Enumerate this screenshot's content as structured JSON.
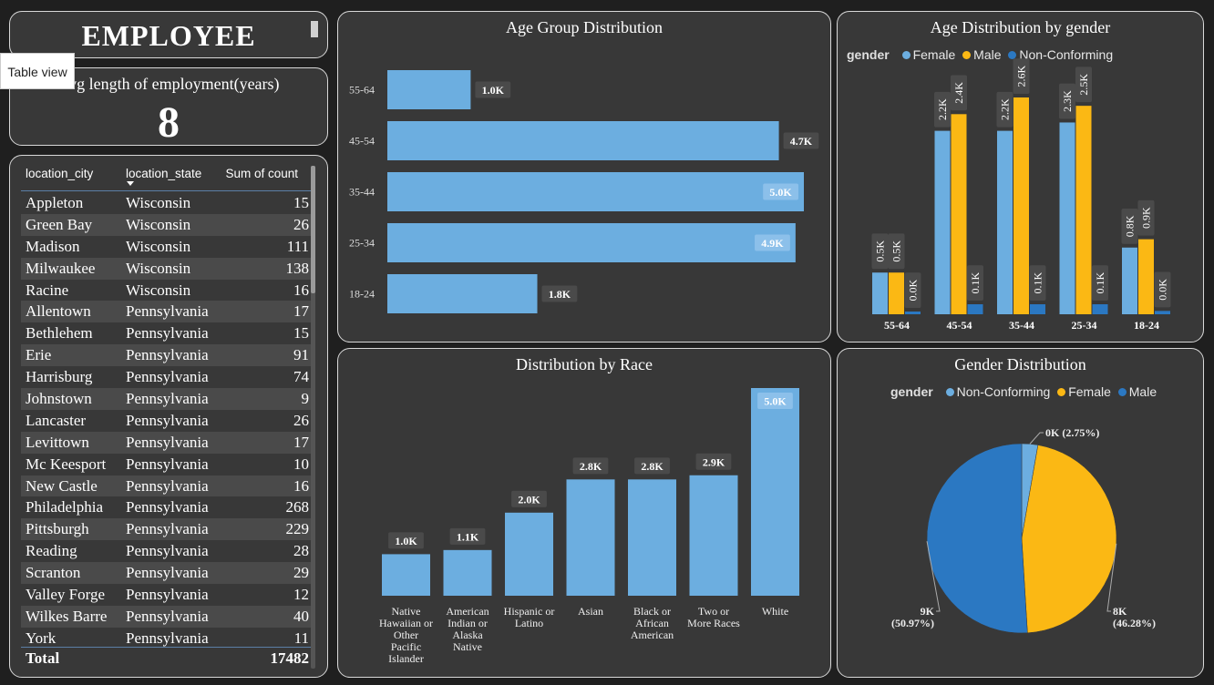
{
  "title": "EMPLOYEE",
  "tooltip": "Table view",
  "kpi": {
    "label": "Avg length of employment(years)",
    "value": "8"
  },
  "table": {
    "headers": [
      "location_city",
      "location_state",
      "Sum of count"
    ],
    "rows": [
      [
        "Appleton",
        "Wisconsin",
        "15"
      ],
      [
        "Green Bay",
        "Wisconsin",
        "26"
      ],
      [
        "Madison",
        "Wisconsin",
        "111"
      ],
      [
        "Milwaukee",
        "Wisconsin",
        "138"
      ],
      [
        "Racine",
        "Wisconsin",
        "16"
      ],
      [
        "Allentown",
        "Pennsylvania",
        "17"
      ],
      [
        "Bethlehem",
        "Pennsylvania",
        "15"
      ],
      [
        "Erie",
        "Pennsylvania",
        "91"
      ],
      [
        "Harrisburg",
        "Pennsylvania",
        "74"
      ],
      [
        "Johnstown",
        "Pennsylvania",
        "9"
      ],
      [
        "Lancaster",
        "Pennsylvania",
        "26"
      ],
      [
        "Levittown",
        "Pennsylvania",
        "17"
      ],
      [
        "Mc Keesport",
        "Pennsylvania",
        "10"
      ],
      [
        "New Castle",
        "Pennsylvania",
        "16"
      ],
      [
        "Philadelphia",
        "Pennsylvania",
        "268"
      ],
      [
        "Pittsburgh",
        "Pennsylvania",
        "229"
      ],
      [
        "Reading",
        "Pennsylvania",
        "28"
      ],
      [
        "Scranton",
        "Pennsylvania",
        "29"
      ],
      [
        "Valley Forge",
        "Pennsylvania",
        "12"
      ],
      [
        "Wilkes Barre",
        "Pennsylvania",
        "40"
      ],
      [
        "York",
        "Pennsylvania",
        "11"
      ]
    ],
    "total_label": "Total",
    "total_value": "17482"
  },
  "colors": {
    "female": "#6caee0",
    "male": "#fbb814",
    "nonconforming": "#2b78c2",
    "bar": "#6caee0",
    "panel": "#383838",
    "label_box": "#4a4a4a"
  },
  "chart_data": [
    {
      "type": "bar",
      "orientation": "horizontal",
      "title": "Age Group Distribution",
      "categories": [
        "55-64",
        "45-54",
        "35-44",
        "25-34",
        "18-24"
      ],
      "values": [
        1000,
        4700,
        5000,
        4900,
        1800
      ],
      "labels": [
        "1.0K",
        "4.7K",
        "5.0K",
        "4.9K",
        "1.8K"
      ],
      "xlim": [
        0,
        5000
      ]
    },
    {
      "type": "bar",
      "title": "Age Distribution by gender",
      "legend_title": "gender",
      "legend_position": "top-left",
      "categories": [
        "55-64",
        "45-54",
        "35-44",
        "25-34",
        "18-24"
      ],
      "series": [
        {
          "name": "Female",
          "values": [
            500,
            2200,
            2200,
            2300,
            800
          ],
          "labels": [
            "0.5K",
            "2.2K",
            "2.2K",
            "2.3K",
            "0.8K"
          ]
        },
        {
          "name": "Male",
          "values": [
            500,
            2400,
            2600,
            2500,
            900
          ],
          "labels": [
            "0.5K",
            "2.4K",
            "2.6K",
            "2.5K",
            "0.9K"
          ]
        },
        {
          "name": "Non-Conforming",
          "values": [
            20,
            120,
            120,
            120,
            40
          ],
          "labels": [
            "0.0K",
            "0.1K",
            "0.1K",
            "0.1K",
            "0.0K"
          ]
        }
      ],
      "ylim": [
        0,
        2600
      ]
    },
    {
      "type": "bar",
      "title": "Distribution by Race",
      "categories": [
        "Native Hawaiian or Other Pacific Islander",
        "American Indian or Alaska Native",
        "Hispanic or Latino",
        "Asian",
        "Black or African American",
        "Two or More Races",
        "White"
      ],
      "category_lines": [
        [
          "Native",
          "Hawaiian or",
          "Other",
          "Pacific",
          "Islander"
        ],
        [
          "American",
          "Indian or",
          "Alaska",
          "Native"
        ],
        [
          "Hispanic or",
          "Latino"
        ],
        [
          "Asian"
        ],
        [
          "Black or",
          "African",
          "American"
        ],
        [
          "Two or",
          "More Races"
        ],
        [
          "White"
        ]
      ],
      "values": [
        1000,
        1100,
        2000,
        2800,
        2800,
        2900,
        5000
      ],
      "labels": [
        "1.0K",
        "1.1K",
        "2.0K",
        "2.8K",
        "2.8K",
        "2.9K",
        "5.0K"
      ],
      "ylim": [
        0,
        5000
      ]
    },
    {
      "type": "pie",
      "title": "Gender Distribution",
      "legend_title": "gender",
      "legend_position": "top-center",
      "slices": [
        {
          "name": "Non-Conforming",
          "percent": 2.75,
          "label": "0K (2.75%)"
        },
        {
          "name": "Female",
          "percent": 46.28,
          "label": "8K",
          "label2": "(46.28%)"
        },
        {
          "name": "Male",
          "percent": 50.97,
          "label": "9K",
          "label2": "(50.97%)"
        }
      ]
    }
  ]
}
